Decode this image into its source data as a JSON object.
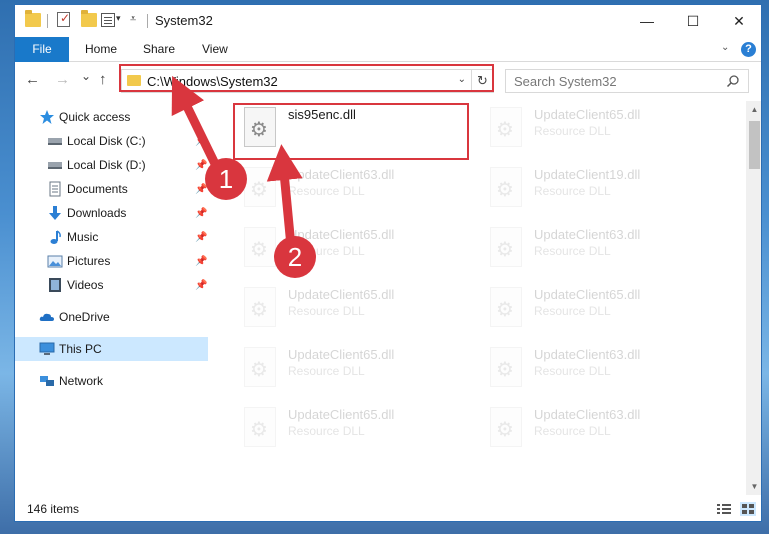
{
  "window": {
    "title": "System32"
  },
  "ribbon": {
    "tabs": [
      {
        "label": "File"
      },
      {
        "label": "Home"
      },
      {
        "label": "Share"
      },
      {
        "label": "View"
      }
    ],
    "help_label": "?"
  },
  "window_controls": {
    "minimize": "—",
    "maximize": "☐",
    "close": "✕"
  },
  "nav": {
    "back": "←",
    "forward": "→",
    "recent": "⌄",
    "up": "↑",
    "address": "C:\\Windows\\System32",
    "refresh": "↻",
    "search_placeholder": "Search System32"
  },
  "sidebar": {
    "items": [
      {
        "label": "Quick access",
        "icon": "star-icon",
        "pinned": false
      },
      {
        "label": "Local Disk (C:)",
        "icon": "drive-icon",
        "pinned": true
      },
      {
        "label": "Local Disk (D:)",
        "icon": "drive-icon",
        "pinned": true
      },
      {
        "label": "Documents",
        "icon": "documents-icon",
        "pinned": true
      },
      {
        "label": "Downloads",
        "icon": "download-icon",
        "pinned": true
      },
      {
        "label": "Music",
        "icon": "music-icon",
        "pinned": true
      },
      {
        "label": "Pictures",
        "icon": "pictures-icon",
        "pinned": true
      },
      {
        "label": "Videos",
        "icon": "videos-icon",
        "pinned": true
      },
      {
        "label": "OneDrive",
        "icon": "cloud-icon",
        "pinned": false
      },
      {
        "label": "This PC",
        "icon": "computer-icon",
        "pinned": false,
        "selected": true
      },
      {
        "label": "Network",
        "icon": "network-icon",
        "pinned": false
      }
    ]
  },
  "files": [
    {
      "name": "sis95enc.dll",
      "type": "",
      "highlighted": true
    },
    {
      "name": "UpdateClient65.dll",
      "type": "Resource DLL"
    },
    {
      "name": "UpdateClient63.dll",
      "type": "Resource DLL"
    },
    {
      "name": "UpdateClient19.dll",
      "type": "Resource DLL"
    },
    {
      "name": "UpdateClient65.dll",
      "type": "Resource DLL"
    },
    {
      "name": "UpdateClient63.dll",
      "type": "Resource DLL"
    },
    {
      "name": "UpdateClient65.dll",
      "type": "Resource DLL"
    },
    {
      "name": "UpdateClient65.dll",
      "type": "Resource DLL"
    },
    {
      "name": "UpdateClient65.dll",
      "type": "Resource DLL"
    },
    {
      "name": "UpdateClient63.dll",
      "type": "Resource DLL"
    },
    {
      "name": "UpdateClient65.dll",
      "type": "Resource DLL"
    },
    {
      "name": "UpdateClient63.dll",
      "type": "Resource DLL"
    }
  ],
  "status": {
    "item_count": "146 items"
  },
  "annotations": {
    "badge_1": "1",
    "badge_2": "2",
    "color": "#d9363e"
  },
  "colors": {
    "accent": "#1979ca",
    "selection": "#cce8ff",
    "highlight": "#d9363e"
  }
}
